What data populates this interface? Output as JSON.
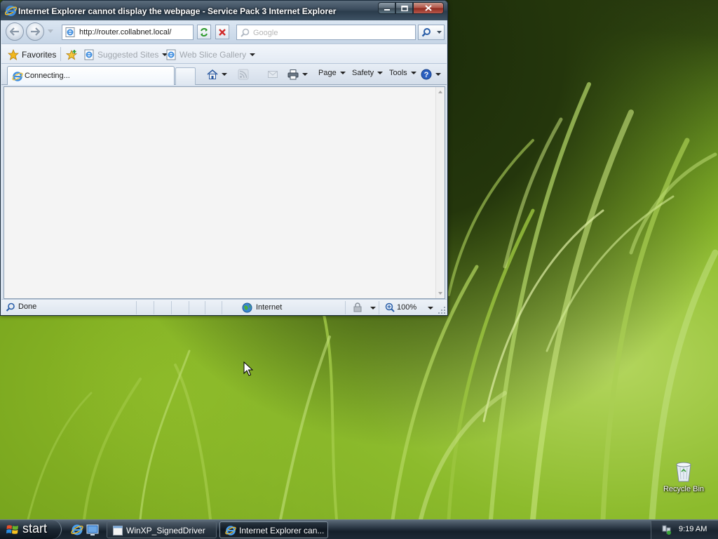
{
  "window": {
    "title": "Internet Explorer cannot display the webpage - Service Pack 3 Internet Explorer",
    "address": "http://router.collabnet.local/",
    "search_placeholder": "Google",
    "caption_buttons": [
      "minimize",
      "maximize",
      "close"
    ]
  },
  "favorites_bar": {
    "favorites_label": "Favorites",
    "items": [
      {
        "label": "Suggested Sites",
        "icon": "ie-page-icon",
        "has_dropdown": true
      },
      {
        "label": "Web Slice Gallery",
        "icon": "ie-page-icon",
        "has_dropdown": true
      }
    ]
  },
  "tab": {
    "label": "Connecting..."
  },
  "command_bar": {
    "items": [
      {
        "label": "Page"
      },
      {
        "label": "Safety"
      },
      {
        "label": "Tools"
      }
    ],
    "icons": [
      "home-icon",
      "rss-feed-icon",
      "read-mail-icon",
      "print-icon",
      "help-icon"
    ]
  },
  "status_bar": {
    "status": "Done",
    "zone": "Internet",
    "zoom": "100%"
  },
  "desktop": {
    "icons": [
      {
        "label": "Recycle Bin",
        "icon": "recycle-bin-icon"
      }
    ]
  },
  "taskbar": {
    "start_label": "start",
    "quick_launch": [
      "ie-icon",
      "show-desktop-icon"
    ],
    "buttons": [
      {
        "label": "WinXP_SignedDriver",
        "icon": "window-icon",
        "active": false
      },
      {
        "label": "Internet Explorer can...",
        "icon": "ie-icon",
        "active": true
      }
    ],
    "clock": "9:19 AM"
  }
}
